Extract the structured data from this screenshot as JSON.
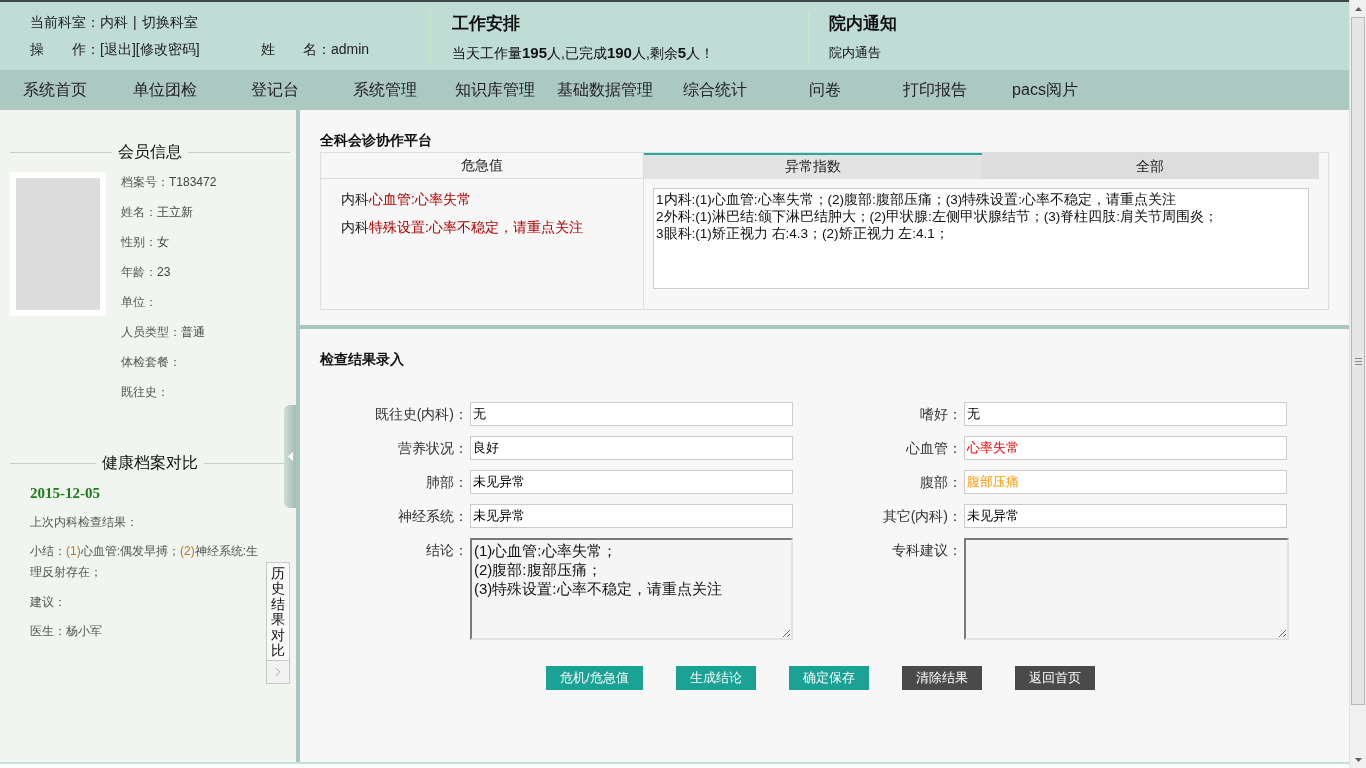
{
  "header": {
    "department": "当前科室：内科",
    "separator": "|",
    "switch_link": "切换科室",
    "operations_label": "操　　作：",
    "operation_links": [
      "[退出]",
      "[修改密码]"
    ],
    "user": "姓　　名：admin"
  },
  "work": {
    "title": "工作安排",
    "summary": "当天工作量**195**人,已完成**190**人,剩余**5**人！"
  },
  "notice": {
    "title": "院内通知",
    "items": [
      "院内通告"
    ]
  },
  "nav": [
    "系统首页",
    "单位团检",
    "登记台",
    "系统管理",
    "知识库管理",
    "基础数据管理",
    "综合统计",
    "问卷",
    "打印报告",
    "pacs阅片"
  ],
  "member_info": {
    "title": "会员信息",
    "fields": [
      {
        "label": "档案号：",
        "value": "T183472"
      },
      {
        "label": "姓名：",
        "value": "王立新"
      },
      {
        "label": "性别：",
        "value": "女"
      },
      {
        "label": "年龄：",
        "value": "23"
      },
      {
        "label": "单位："
      },
      {
        "label": "人员类型：",
        "value": "普通"
      },
      {
        "label": "体检套餐："
      },
      {
        "label": "既往史："
      }
    ]
  },
  "health_compare": {
    "title": "健康档案对比",
    "date": "2015-12-05",
    "heading": "上次内科检查结果：",
    "summary": {
      "label": "小结：",
      "items": [
        {
          "index": "(1)",
          "text": "心血管:偶发早搏；"
        },
        {
          "index": "(2)",
          "text": "神经系统:生理反射存在；"
        }
      ]
    },
    "advice": "建议：",
    "doctor": "医生：杨小军"
  },
  "history_tab": {
    "label": "历史结果对比"
  },
  "consult": {
    "title": "全科会诊协作平台",
    "critical": {
      "header": "危急值",
      "items": [
        {
          "dept": "内科",
          "finding": "心血管:心率失常"
        },
        {
          "dept": "内科",
          "finding": "特殊设置:心率不稳定，请重点关注"
        }
      ]
    },
    "tabs": [
      {
        "label": "异常指数",
        "selected": true
      },
      {
        "label": "全部",
        "selected": false
      }
    ],
    "abnormal_lines": [
      "1内科:(1)心血管:心率失常；(2)腹部:腹部压痛；(3)特殊设置:心率不稳定，请重点关注",
      "2外科:(1)淋巴结:颌下淋巴结肿大；(2)甲状腺:左侧甲状腺结节；(3)脊柱四肢:肩关节周围炎；",
      "3眼科:(1)矫正视力 右:4.3；(2)矫正视力 左:4.1；"
    ]
  },
  "entry": {
    "title": "检查结果录入",
    "fields": [
      {
        "kind": "input",
        "label": "既往史(内科)：",
        "value": "无",
        "abnormal": false,
        "critical": false
      },
      {
        "kind": "input",
        "label": "嗜好：",
        "value": "无",
        "abnormal": false,
        "critical": false
      },
      {
        "kind": "input",
        "label": "营养状况：",
        "value": "良好",
        "abnormal": false,
        "critical": false
      },
      {
        "kind": "input",
        "label": "心血管：",
        "value": "心率失常",
        "abnormal": true,
        "critical": true
      },
      {
        "kind": "input",
        "label": "肺部：",
        "value": "未见异常",
        "abnormal": false,
        "critical": false
      },
      {
        "kind": "input",
        "label": "腹部：",
        "value": "腹部压痛",
        "abnormal": true,
        "critical": false
      },
      {
        "kind": "input",
        "label": "神经系统：",
        "value": "未见异常",
        "abnormal": false,
        "critical": false
      },
      {
        "kind": "input",
        "label": "其它(内科)：",
        "value": "未见异常",
        "abnormal": false,
        "critical": false
      },
      {
        "kind": "textarea",
        "label": "结论：",
        "value": "(1)心血管:心率失常；\n(2)腹部:腹部压痛；\n(3)特殊设置:心率不稳定，请重点关注"
      },
      {
        "kind": "textarea",
        "label": "专科建议："
      }
    ],
    "buttons": [
      {
        "label": "危机/危急值",
        "kind": "primary"
      },
      {
        "label": "生成结论",
        "kind": "primary"
      },
      {
        "label": "确定保存",
        "kind": "primary"
      },
      {
        "label": "清除结果",
        "kind": "secondary"
      },
      {
        "label": "返回首页",
        "kind": "secondary"
      }
    ]
  }
}
